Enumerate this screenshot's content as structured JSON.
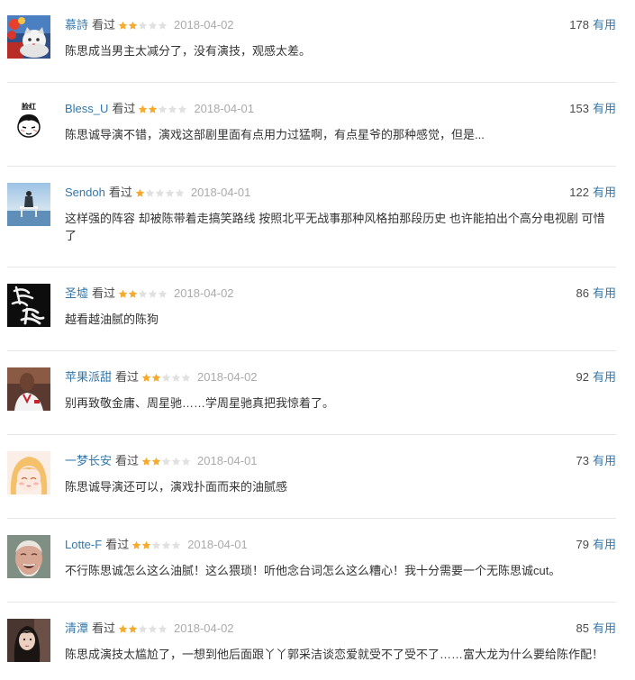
{
  "colors": {
    "link": "#3377aa",
    "text": "#333333",
    "meta": "#494949",
    "date": "#aaaaaa",
    "star_filled": "#f6ab2f",
    "star_empty": "#e1e1e1",
    "divider": "#e6e6e6"
  },
  "comments": [
    {
      "user": "慕詩",
      "status": "看过",
      "rating": 2,
      "date": "2018-04-02",
      "votes": "178",
      "vote_label": "有用",
      "text": "陈思成当男主太减分了，没有演技，观感太差。"
    },
    {
      "user": "Bless_U",
      "status": "看过",
      "rating": 2,
      "date": "2018-04-01",
      "votes": "153",
      "vote_label": "有用",
      "text": "陈思诚导演不错，演戏这部剧里面有点用力过猛啊，有点星爷的那种感觉，但是...",
      "avatar_caption": "脸红"
    },
    {
      "user": "Sendoh",
      "status": "看过",
      "rating": 1,
      "date": "2018-04-01",
      "votes": "122",
      "vote_label": "有用",
      "text": "这样强的阵容 却被陈带着走搞笑路线 按照北平无战事那种风格拍那段历史 也许能拍出个高分电视剧 可惜了"
    },
    {
      "user": "圣墟",
      "status": "看过",
      "rating": 2,
      "date": "2018-04-02",
      "votes": "86",
      "vote_label": "有用",
      "text": "越看越油腻的陈狗"
    },
    {
      "user": "苹果派甜",
      "status": "看过",
      "rating": 2,
      "date": "2018-04-02",
      "votes": "92",
      "vote_label": "有用",
      "text": "别再致敬金庸、周星驰……学周星驰真把我惊着了。"
    },
    {
      "user": "一梦长安",
      "status": "看过",
      "rating": 2,
      "date": "2018-04-01",
      "votes": "73",
      "vote_label": "有用",
      "text": "陈思诚导演还可以，演戏扑面而来的油腻感"
    },
    {
      "user": "Lotte-F",
      "status": "看过",
      "rating": 2,
      "date": "2018-04-01",
      "votes": "79",
      "vote_label": "有用",
      "text": "不行陈思诚怎么这么油腻！这么猥琐！听他念台词怎么这么糟心！我十分需要一个无陈思诚cut。"
    },
    {
      "user": "清潭",
      "status": "看过",
      "rating": 2,
      "date": "2018-04-02",
      "votes": "85",
      "vote_label": "有用",
      "text": "陈思成演技太尴尬了，一想到他后面跟丫丫郭采洁谈恋爱就受不了受不了……富大龙为什么要给陈作配！"
    }
  ]
}
